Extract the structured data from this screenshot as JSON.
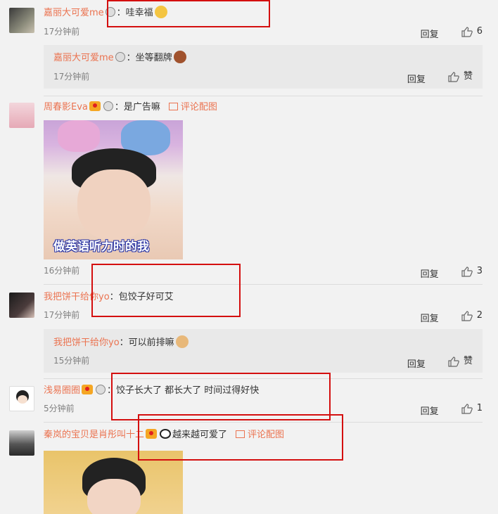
{
  "comments": [
    {
      "user": "嘉丽大可爱me",
      "text": "：哇幸福",
      "time": "17分钟前",
      "reply_label": "回复",
      "likes": "6",
      "replies": [
        {
          "user": "嘉丽大可爱me",
          "text": "：坐等翻牌",
          "time": "17分钟前",
          "reply_label": "回复",
          "like_label": "赞"
        }
      ]
    },
    {
      "user": "周春影Eva",
      "text": "：是广告嘛",
      "pic_link": "评论配图",
      "image_caption": "做英语听力时的我",
      "time": "16分钟前",
      "reply_label": "回复",
      "likes": "3"
    },
    {
      "user": "我把饼干给你yo",
      "text": "：包饺子好可艾",
      "time": "17分钟前",
      "reply_label": "回复",
      "likes": "2",
      "replies": [
        {
          "user": "我把饼干给你yo",
          "text": "：可以前排嘛",
          "time": "15分钟前",
          "reply_label": "回复",
          "like_label": "赞"
        }
      ]
    },
    {
      "user": "浅易圈圈",
      "text": "：饺子长大了 都长大了 时间过得好快",
      "time": "5分钟前",
      "reply_label": "回复",
      "likes": "1"
    },
    {
      "user": "秦岚的宝贝是肖彤叫十二",
      "text": "越来越可爱了",
      "pic_link": "评论配图"
    }
  ],
  "colors": {
    "username": "#eb7350",
    "highlight_box": "#d40f0f",
    "reply_bg": "#e9e9e9"
  },
  "icons": [
    "medal-icon",
    "vip-icon",
    "emoji-icon",
    "like-icon",
    "image-icon",
    "panda-icon"
  ]
}
